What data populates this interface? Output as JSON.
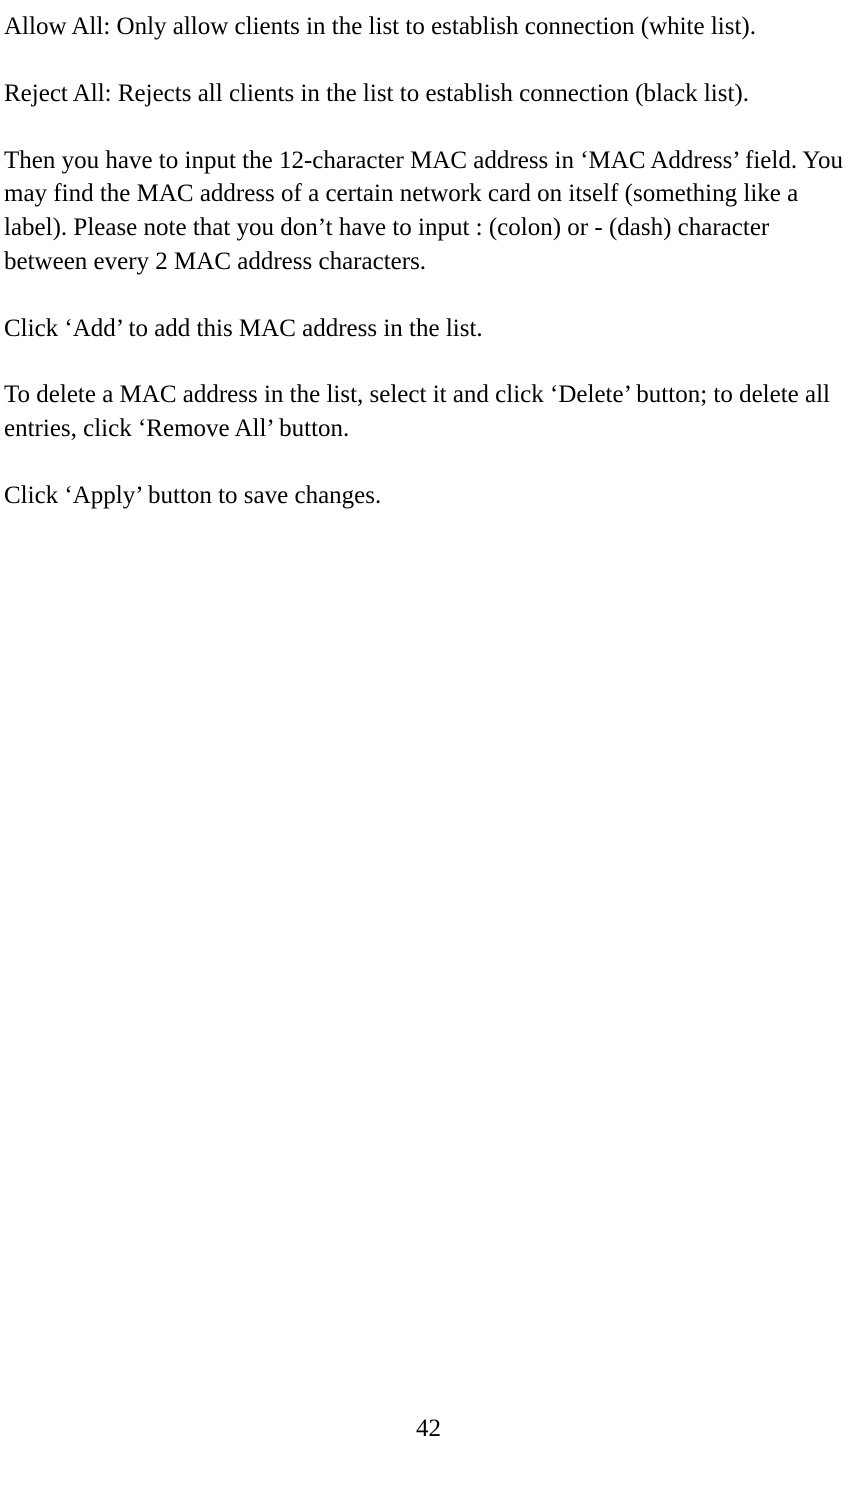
{
  "paragraphs": {
    "p1": "Allow All: Only allow clients in the list to establish connection (white list).",
    "p2": "Reject All: Rejects all clients in the list to establish connection (black list).",
    "p3": "Then you have to input the 12-character MAC address in ‘MAC Address’ field. You may find the MAC address of a certain network card on itself (something like a label). Please note that you don’t have to input : (colon) or - (dash) character between every 2 MAC address characters.",
    "p4": "Click ‘Add’ to add this MAC address in the list.",
    "p5": "To delete a MAC address in the list, select it and click ‘Delete’ button; to delete all entries, click ‘Remove All’ button.",
    "p6": "Click ‘Apply’ button to save changes."
  },
  "page_number": "42"
}
